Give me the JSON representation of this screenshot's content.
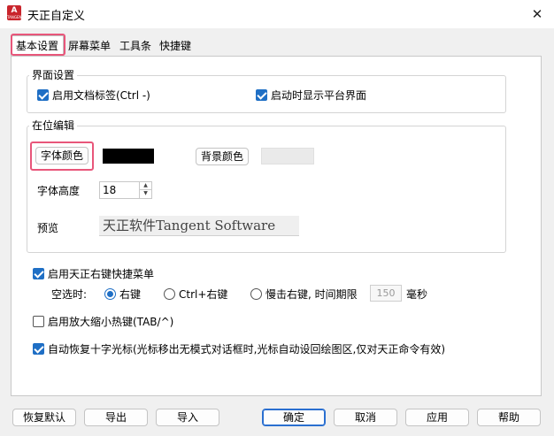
{
  "window": {
    "title": "天正自定义",
    "icon_text": "A",
    "icon_subtext": "TANGENT"
  },
  "tabs": [
    {
      "label": "基本设置",
      "active": true
    },
    {
      "label": "屏幕菜单",
      "active": false
    },
    {
      "label": "工具条",
      "active": false
    },
    {
      "label": "快捷键",
      "active": false
    }
  ],
  "interface_group": {
    "title": "界面设置",
    "enable_doc_tabs": {
      "label": "启用文档标签(Ctrl -)",
      "checked": true
    },
    "show_platform": {
      "label": "启动时显示平台界面",
      "checked": true
    }
  },
  "inplace_group": {
    "title": "在位编辑",
    "font_color_button": "字体颜色",
    "font_color": "#000000",
    "bg_color_button": "背景颜色",
    "bg_color": "#eaeaea",
    "font_height_label": "字体高度",
    "font_height_value": "18",
    "preview_label": "预览",
    "preview_text": "天正软件Tangent Software"
  },
  "right_click_menu": {
    "label": "启用天正右键快捷菜单",
    "checked": true,
    "empty_select_label": "空选时:",
    "options": [
      {
        "label": "右键",
        "selected": true
      },
      {
        "label": "Ctrl+右键",
        "selected": false
      },
      {
        "label": "慢击右键, 时间期限",
        "selected": false
      }
    ],
    "time_value": "150",
    "time_unit": "毫秒"
  },
  "zoom_hotkey": {
    "label": "启用放大缩小热键(TAB/^)",
    "checked": false
  },
  "auto_cursor": {
    "label": "自动恢复十字光标(光标移出无模式对话框时,光标自动设回绘图区,仅对天正命令有效)",
    "checked": true
  },
  "buttons": {
    "restore_default": "恢复默认",
    "export": "导出",
    "import": "导入",
    "ok": "确定",
    "cancel": "取消",
    "apply": "应用",
    "help": "帮助"
  },
  "colors": {
    "accent": "#1f6fc5",
    "highlight": "#e8567a",
    "brand": "#c9252c"
  }
}
